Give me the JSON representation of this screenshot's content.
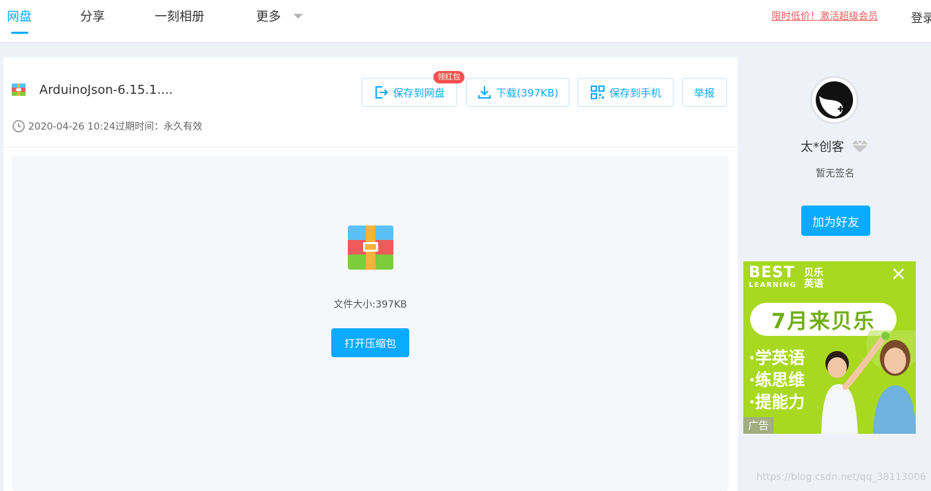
{
  "nav": {
    "items": [
      {
        "label": "网盘",
        "active": true
      },
      {
        "label": "分享",
        "active": false
      },
      {
        "label": "一刻相册",
        "active": false
      },
      {
        "label": "更多",
        "active": false
      }
    ],
    "promo": "限时低价！激活超级会员",
    "login": "登录"
  },
  "file": {
    "name": "ArduinoJson-6.15.1....",
    "meta": "2020-04-26 10:24过期时间：永久有效",
    "size_text": "文件大小:397KB",
    "open_button": "打开压缩包"
  },
  "actions": {
    "save_label": "保存到网盘",
    "save_badge": "领红包",
    "download_label": "下载(397KB)",
    "save_phone_label": "保存到手机",
    "report_label": "举报"
  },
  "user": {
    "name": "太*创客",
    "signature": "暂无签名",
    "add_friend": "加为好友"
  },
  "ad": {
    "brand": "BEST",
    "brand_sub": "LEARNING",
    "brand_cn": "贝乐英语",
    "headline": "7月来贝乐",
    "lines": [
      "·学英语",
      "·练思维",
      "·提能力"
    ],
    "label": "广告"
  },
  "watermark": "https://blog.csdn.net/qq_38113006",
  "colors": {
    "accent": "#09aaff",
    "promo": "#e95a5a",
    "badge": "#f5504f",
    "ad_background": "#a8d820"
  },
  "icons": {
    "file_small": "zip-archive-icon",
    "clock": "clock-icon",
    "save": "save-to-disk-icon",
    "download": "download-icon",
    "qr": "qr-code-icon",
    "diamond": "vip-diamond-icon",
    "close": "close-icon"
  }
}
